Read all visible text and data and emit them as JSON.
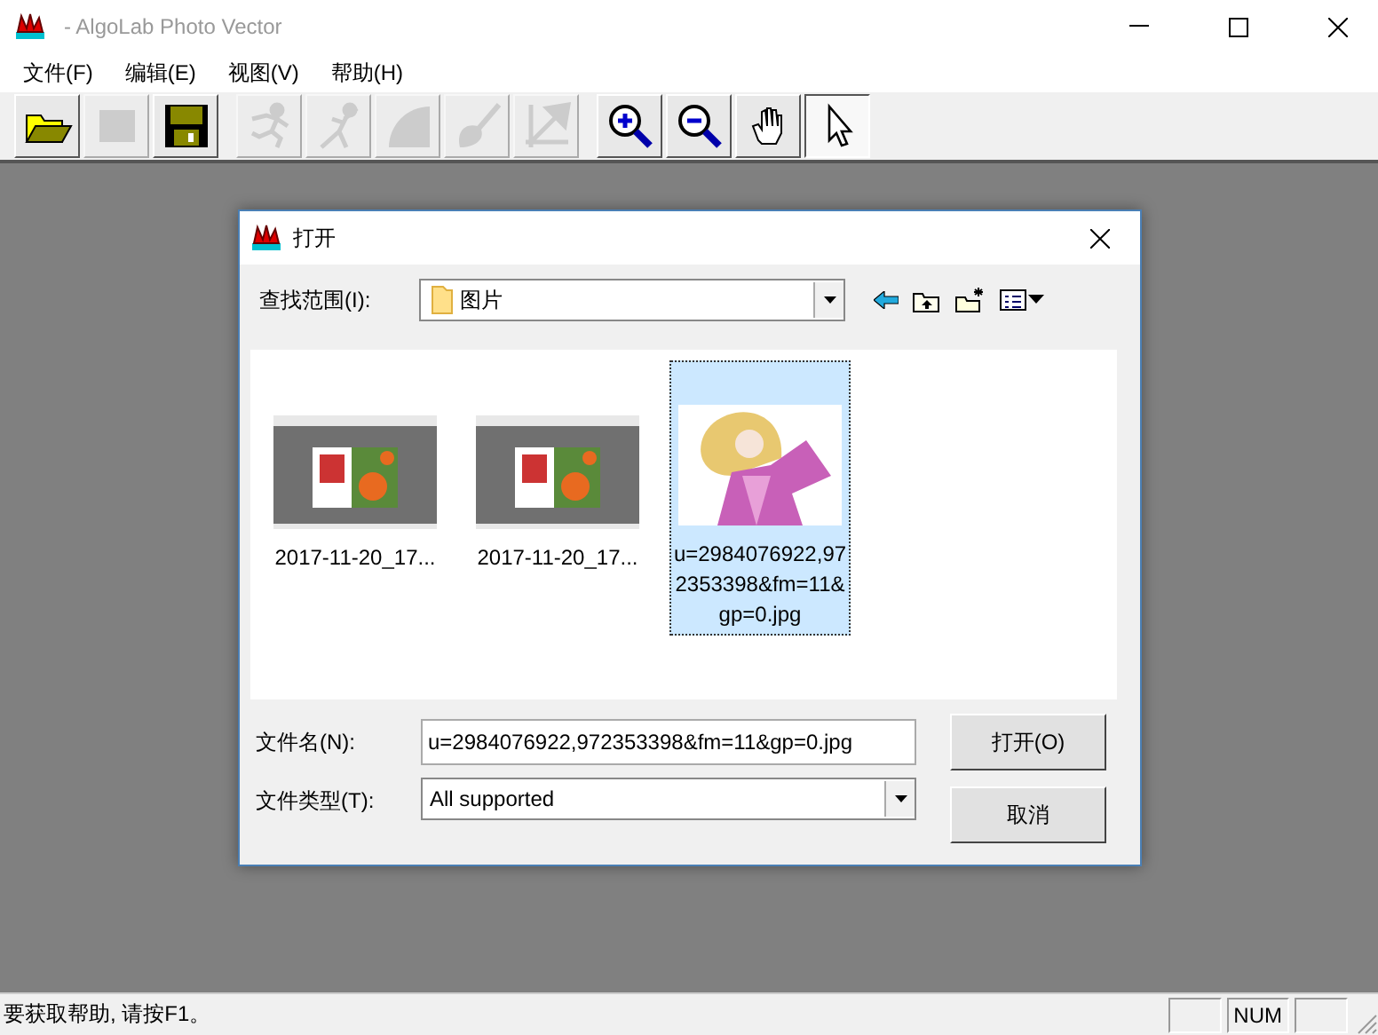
{
  "window": {
    "title": "- AlgoLab Photo Vector"
  },
  "menu": [
    "文件(F)",
    "编辑(E)",
    "视图(V)",
    "帮助(H)"
  ],
  "toolbar_groups": [
    {
      "buttons": [
        {
          "kind": "open",
          "disabled": false,
          "selected": false
        },
        {
          "kind": "stop",
          "disabled": true,
          "selected": false
        },
        {
          "kind": "save",
          "disabled": false,
          "selected": false
        }
      ]
    },
    {
      "buttons": [
        {
          "kind": "run",
          "disabled": true,
          "selected": false
        },
        {
          "kind": "walk",
          "disabled": true,
          "selected": false
        },
        {
          "kind": "quarter",
          "disabled": true,
          "selected": false
        },
        {
          "kind": "brush",
          "disabled": true,
          "selected": false
        },
        {
          "kind": "arrow",
          "disabled": true,
          "selected": false
        }
      ]
    },
    {
      "buttons": [
        {
          "kind": "zoom-in",
          "disabled": false,
          "selected": false
        },
        {
          "kind": "zoom-out",
          "disabled": false,
          "selected": false
        },
        {
          "kind": "hand",
          "disabled": false,
          "selected": false
        },
        {
          "kind": "pointer",
          "disabled": false,
          "selected": true
        }
      ]
    }
  ],
  "dialog": {
    "title": "打开",
    "look_in_label": "查找范围(I):",
    "look_in_value": "图片",
    "files": [
      {
        "name": "2017-11-20_17...",
        "selected": false,
        "kind": "screenshot"
      },
      {
        "name": "2017-11-20_17...",
        "selected": false,
        "kind": "screenshot"
      },
      {
        "name": "u=2984076922,972353398&fm=11&gp=0.jpg",
        "selected": true,
        "kind": "figure"
      }
    ],
    "filename_label": "文件名(N):",
    "filename_value": "u=2984076922,972353398&fm=11&gp=0.jpg",
    "filetype_label": "文件类型(T):",
    "filetype_value": "All supported",
    "open_button": "打开(O)",
    "cancel_button": "取消"
  },
  "status_bar": {
    "text": "要获取帮助, 请按F1。",
    "indicators": [
      "NUM"
    ]
  }
}
